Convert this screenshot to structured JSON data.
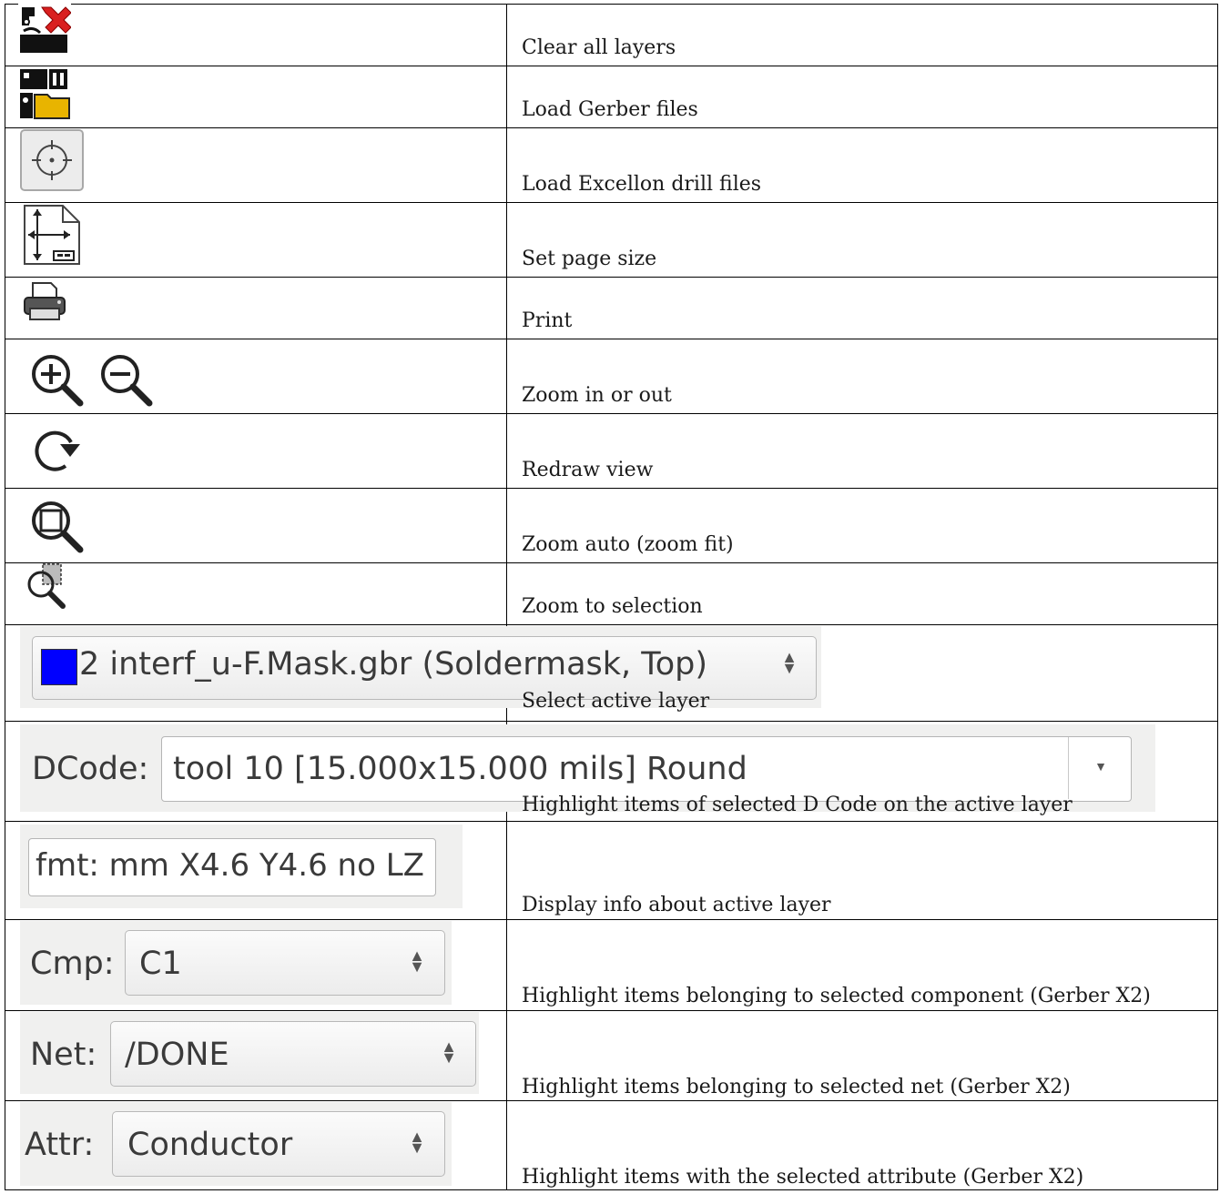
{
  "rows": [
    {
      "icon": "clear-layers-icon",
      "description": "Clear all layers"
    },
    {
      "icon": "load-gerber-icon",
      "description": "Load Gerber files"
    },
    {
      "icon": "load-drill-icon",
      "description": "Load Excellon drill files"
    },
    {
      "icon": "page-size-icon",
      "description": "Set page size"
    },
    {
      "icon": "printer-icon",
      "description": "Print"
    },
    {
      "icon": "zoom-in-out-icon",
      "description": "Zoom in or out"
    },
    {
      "icon": "redraw-icon",
      "description": "Redraw view"
    },
    {
      "icon": "zoom-fit-icon",
      "description": "Zoom auto (zoom fit)"
    },
    {
      "icon": "zoom-selection-icon",
      "description": "Zoom to selection"
    },
    {
      "icon": "layer-select",
      "description": "Select active layer"
    },
    {
      "icon": "dcode-select",
      "description": "Highlight items of selected D Code on the active layer"
    },
    {
      "icon": "format-info",
      "description": "Display info about active layer"
    },
    {
      "icon": "component-select",
      "description": "Highlight items belonging to selected component (Gerber X2)"
    },
    {
      "icon": "net-select",
      "description": "Highlight items belonging to selected net (Gerber X2)"
    },
    {
      "icon": "attribute-select",
      "description": "Highlight items with the selected attribute (Gerber X2)"
    }
  ],
  "widgets": {
    "layer": {
      "value": "2 interf_u-F.Mask.gbr (Soldermask, Top)",
      "swatch_color": "#0000ff"
    },
    "dcode": {
      "label": "DCode:",
      "value": "tool 10 [15.000x15.000 mils] Round"
    },
    "format": {
      "value": "fmt: mm X4.6 Y4.6 no LZ"
    },
    "component": {
      "label": "Cmp:",
      "value": "C1"
    },
    "net": {
      "label": "Net:",
      "value": "/DONE"
    },
    "attribute": {
      "label": "Attr:",
      "value": "Conductor"
    }
  }
}
